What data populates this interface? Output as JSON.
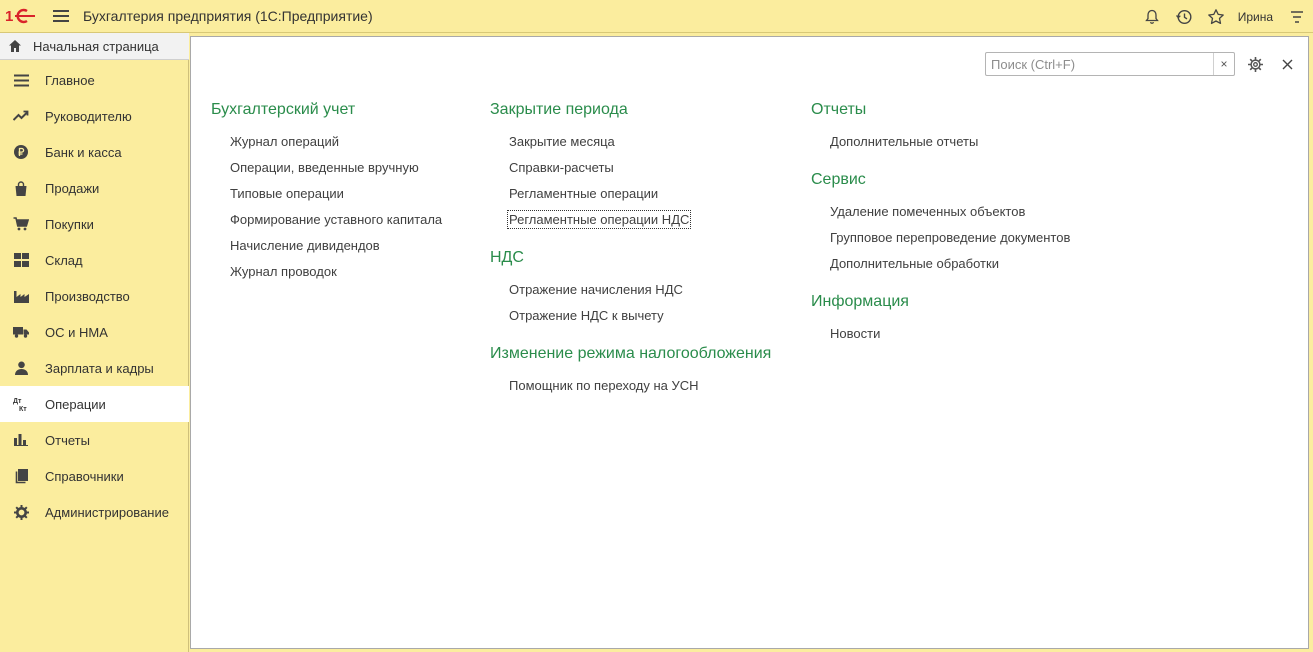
{
  "app": {
    "title": "Бухгалтерия предприятия  (1С:Предприятие)",
    "user": "Ирина",
    "icons": {
      "logo": "1c-logo-icon",
      "menu": "hamburger-icon",
      "notifications": "bell-icon",
      "history": "history-icon",
      "favorites": "star-icon",
      "settings": "settings-menu-icon"
    }
  },
  "sidebar": {
    "home": "Начальная страница",
    "items": [
      {
        "label": "Главное",
        "icon": "list-icon"
      },
      {
        "label": "Руководителю",
        "icon": "trend-icon"
      },
      {
        "label": "Банк и касса",
        "icon": "ruble-icon"
      },
      {
        "label": "Продажи",
        "icon": "bag-icon"
      },
      {
        "label": "Покупки",
        "icon": "cart-icon"
      },
      {
        "label": "Склад",
        "icon": "grid-icon"
      },
      {
        "label": "Производство",
        "icon": "factory-icon"
      },
      {
        "label": "ОС и НМА",
        "icon": "truck-icon"
      },
      {
        "label": "Зарплата и кадры",
        "icon": "person-icon"
      },
      {
        "label": "Операции",
        "icon": "dt-kt-icon",
        "active": true
      },
      {
        "label": "Отчеты",
        "icon": "bar-chart-icon"
      },
      {
        "label": "Справочники",
        "icon": "books-icon"
      },
      {
        "label": "Администрирование",
        "icon": "gear-icon"
      }
    ]
  },
  "search": {
    "placeholder": "Поиск (Ctrl+F)",
    "value": "",
    "clear": "×"
  },
  "sections": {
    "accounting": {
      "title": "Бухгалтерский учет",
      "links": [
        "Журнал операций",
        "Операции, введенные вручную",
        "Типовые операции",
        "Формирование уставного капитала",
        "Начисление дивидендов",
        "Журнал проводок"
      ]
    },
    "period_close": {
      "title": "Закрытие периода",
      "links": [
        "Закрытие месяца",
        "Справки-расчеты",
        "Регламентные операции",
        "Регламентные операции НДС"
      ]
    },
    "vat": {
      "title": "НДС",
      "links": [
        "Отражение начисления НДС",
        "Отражение НДС к вычету"
      ]
    },
    "tax_mode": {
      "title": "Изменение режима налогообложения",
      "links": [
        "Помощник по переходу на УСН"
      ]
    },
    "reports": {
      "title": "Отчеты",
      "links": [
        "Дополнительные отчеты"
      ]
    },
    "service": {
      "title": "Сервис",
      "links": [
        "Удаление помеченных объектов",
        "Групповое перепроведение документов",
        "Дополнительные обработки"
      ]
    },
    "info": {
      "title": "Информация",
      "links": [
        "Новости"
      ]
    }
  },
  "colors": {
    "sidebar_bg": "#fbed9e",
    "section_title": "#2a8c4b",
    "active_item_bg": "#ffffff"
  }
}
